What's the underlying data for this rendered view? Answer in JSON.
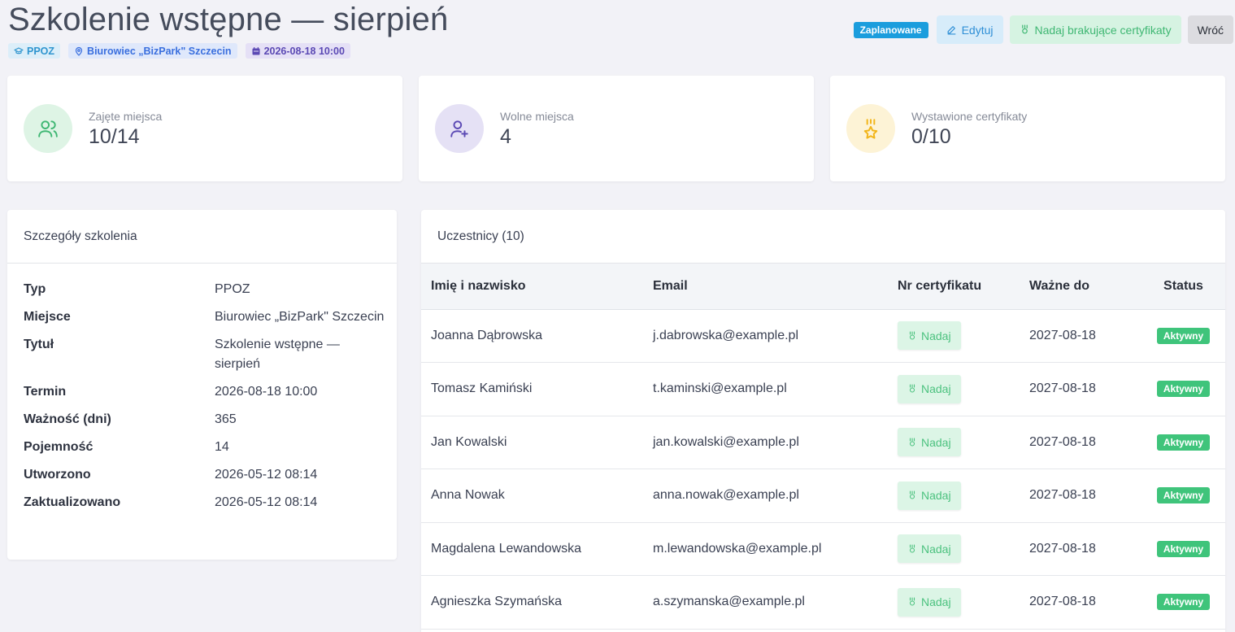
{
  "header": {
    "title": "Szkolenie wstępne — sierpień",
    "tags": {
      "type": "PPOZ",
      "place": "Biurowiec „BizPark\" Szczecin",
      "date": "2026-08-18 10:00"
    },
    "status_badge": "Zaplanowane",
    "edit_label": "Edytuj",
    "grant_missing_label": "Nadaj brakujące certyfikaty",
    "back_label": "Wróć"
  },
  "stats": [
    {
      "label": "Zajęte miejsca",
      "value": "10/14",
      "icon": "users-icon",
      "color": "#3fb773"
    },
    {
      "label": "Wolne miejsca",
      "value": "4",
      "icon": "user-plus-icon",
      "color": "#5b49b4"
    },
    {
      "label": "Wystawione certyfikaty",
      "value": "0/10",
      "icon": "award-star-icon",
      "color": "#f2b519"
    }
  ],
  "details": {
    "heading": "Szczegóły szkolenia",
    "rows": [
      {
        "term": "Typ",
        "value": "PPOZ"
      },
      {
        "term": "Miejsce",
        "value": "Biurowiec „BizPark\" Szczecin"
      },
      {
        "term": "Tytuł",
        "value": "Szkolenie wstępne — sierpień"
      },
      {
        "term": "Termin",
        "value": "2026-08-18 10:00"
      },
      {
        "term": "Ważność (dni)",
        "value": "365"
      },
      {
        "term": "Pojemność",
        "value": "14"
      },
      {
        "term": "Utworzono",
        "value": "2026-05-12 08:14"
      },
      {
        "term": "Zaktualizowano",
        "value": "2026-05-12 08:14"
      }
    ]
  },
  "participants": {
    "heading": "Uczestnicy (10)",
    "columns": [
      "Imię i nazwisko",
      "Email",
      "Nr certyfikatu",
      "Ważne do",
      "Status"
    ],
    "grant_label": "Nadaj",
    "rows": [
      {
        "name": "Joanna Dąbrowska",
        "email": "j.dabrowska@example.pl",
        "valid_until": "2027-08-18",
        "status": "Aktywny"
      },
      {
        "name": "Tomasz Kamiński",
        "email": "t.kaminski@example.pl",
        "valid_until": "2027-08-18",
        "status": "Aktywny"
      },
      {
        "name": "Jan Kowalski",
        "email": "jan.kowalski@example.pl",
        "valid_until": "2027-08-18",
        "status": "Aktywny"
      },
      {
        "name": "Anna Nowak",
        "email": "anna.nowak@example.pl",
        "valid_until": "2027-08-18",
        "status": "Aktywny"
      },
      {
        "name": "Magdalena Lewandowska",
        "email": "m.lewandowska@example.pl",
        "valid_until": "2027-08-18",
        "status": "Aktywny"
      },
      {
        "name": "Agnieszka Szymańska",
        "email": "a.szymanska@example.pl",
        "valid_until": "2027-08-18",
        "status": "Aktywny"
      }
    ]
  },
  "colors": {
    "planned_badge": "#1b9ddd",
    "active_badge": "#3fc47b",
    "background": "#f2f2f7"
  }
}
